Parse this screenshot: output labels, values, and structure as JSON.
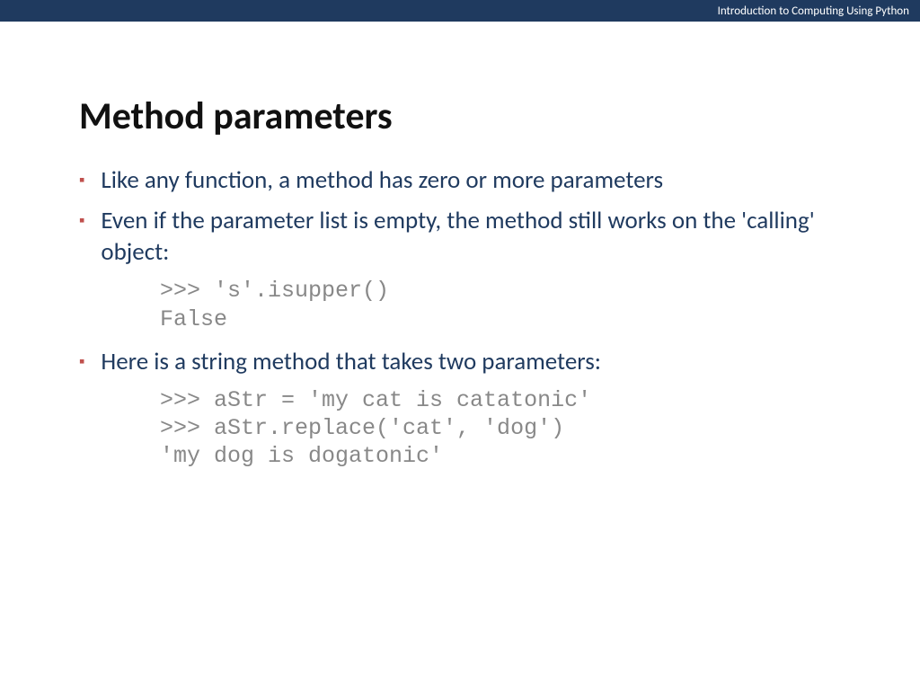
{
  "header": {
    "course_title": "Introduction to Computing Using Python"
  },
  "slide": {
    "title": "Method parameters",
    "bullets": [
      {
        "text": "Like any function, a method has zero or more parameters"
      },
      {
        "text": "Even if the parameter list is empty, the method still works on the 'calling' object:"
      },
      {
        "text": "Here is a string method that takes two parameters:"
      }
    ],
    "code_blocks": [
      ">>> 's'.isupper()\nFalse",
      ">>> aStr = 'my cat is catatonic'\n>>> aStr.replace('cat', 'dog')\n'my dog is dogatonic'"
    ]
  }
}
